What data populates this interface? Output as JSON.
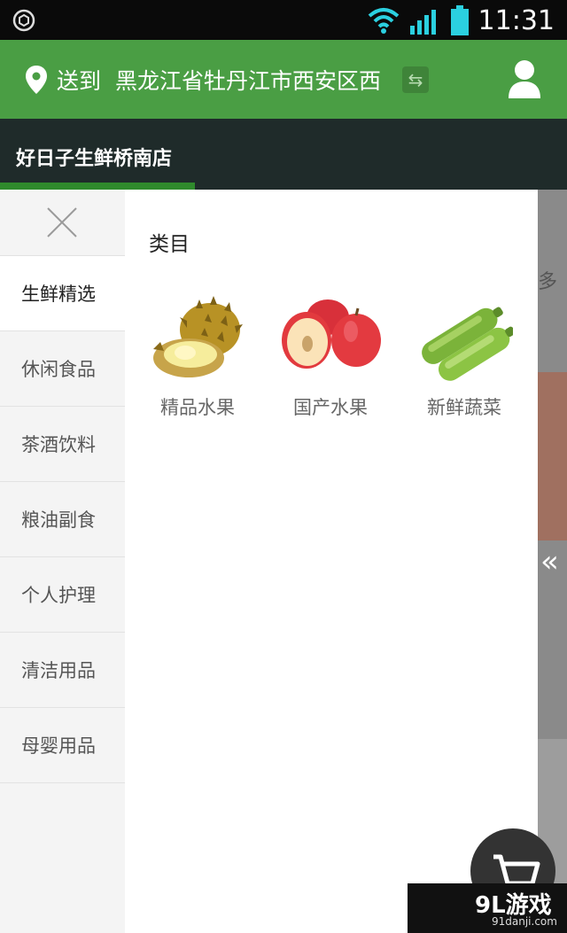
{
  "status_bar": {
    "time": "11:31",
    "icons": [
      "settings-circle-icon",
      "wifi-icon",
      "signal-icon",
      "battery-icon"
    ]
  },
  "header": {
    "deliver_prefix": "送到",
    "address": "黑龙江省牡丹江市西安区西",
    "icons": [
      "location-pin-icon",
      "swap-icon",
      "user-icon"
    ]
  },
  "store": {
    "name": "好日子生鲜桥南店"
  },
  "sidebar": {
    "items": [
      {
        "label": "生鲜精选",
        "active": true
      },
      {
        "label": "休闲食品",
        "active": false
      },
      {
        "label": "茶酒饮料",
        "active": false
      },
      {
        "label": "粮油副食",
        "active": false
      },
      {
        "label": "个人护理",
        "active": false
      },
      {
        "label": "清洁用品",
        "active": false
      },
      {
        "label": "母婴用品",
        "active": false
      }
    ]
  },
  "content": {
    "heading": "类目",
    "subcategories": [
      {
        "label": "精品水果",
        "icon": "durian-icon"
      },
      {
        "label": "国产水果",
        "icon": "apple-icon"
      },
      {
        "label": "新鲜蔬菜",
        "icon": "zucchini-icon"
      }
    ]
  },
  "background_page": {
    "more_text": "多",
    "collapse_glyph": "«"
  },
  "watermark": {
    "main": "9L游戏",
    "sub": "91danji.com"
  },
  "colors": {
    "header_green": "#4a9e44",
    "store_bar": "#1f2b2a",
    "accent_underline": "#2f8a2c"
  }
}
